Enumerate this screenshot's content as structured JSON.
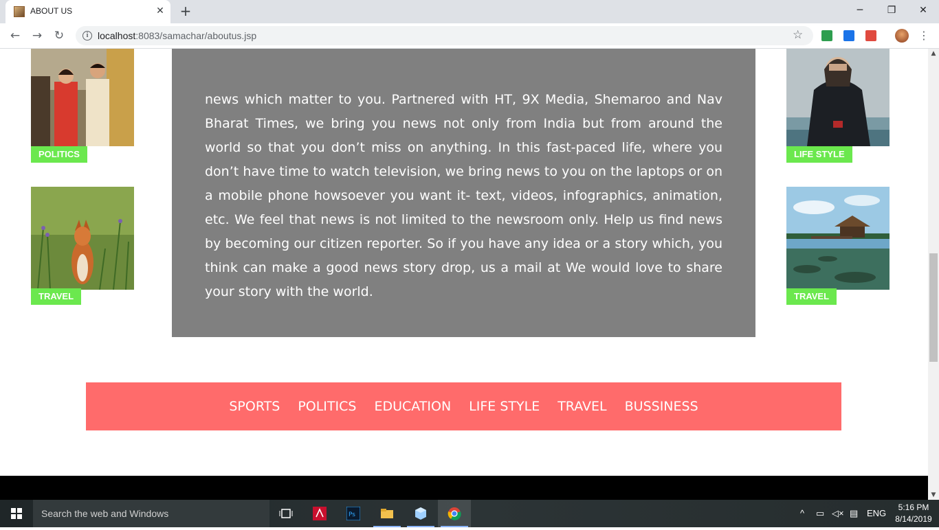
{
  "browser": {
    "tab_title": "ABOUT US",
    "url_host": "localhost",
    "url_rest": ":8083/samachar/aboutus.jsp"
  },
  "page": {
    "left_cards": [
      {
        "tag": "POLITICS",
        "image": "couple-photo"
      },
      {
        "tag": "TRAVEL",
        "image": "fox-photo"
      }
    ],
    "right_cards": [
      {
        "tag": "LIFE STYLE",
        "image": "person-photo"
      },
      {
        "tag": "TRAVEL",
        "image": "beach-hut-photo"
      }
    ],
    "about_text": "news which matter to you. Partnered with HT, 9X Media, Shemaroo and Nav Bharat Times, we bring you news not only from India but from around the world so that you don’t miss on anything. In this fast-paced life, where you don’t have time to watch television, we bring news to you on the laptops or on a mobile phone howsoever you want it- text, videos, infographics, animation, etc. We feel that news is not limited to the newsroom only. Help us find news by becoming our citizen reporter. So if you have any idea or a story which, you think can make a good news story drop, us a mail at We would love to share your story with the world.",
    "categories": [
      "SPORTS",
      "POLITICS",
      "EDUCATION",
      "LIFE STYLE",
      "TRAVEL",
      "BUSSINESS"
    ],
    "colors": {
      "tag_green": "#6be84e",
      "about_gray": "#808080",
      "category_bar": "#ff6b6b",
      "footer": "#000000"
    }
  },
  "taskbar": {
    "search_placeholder": "Search the web and Windows",
    "language": "ENG",
    "time": "5:16 PM",
    "date": "8/14/2019"
  }
}
